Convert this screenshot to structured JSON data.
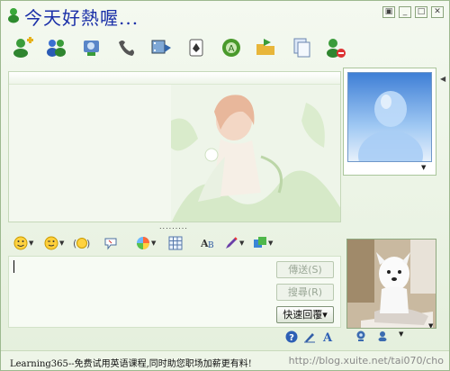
{
  "window": {
    "title": "今天好熱喔...",
    "controls": [
      "▣",
      "_",
      "□",
      "✕"
    ]
  },
  "toolbar": {
    "items": [
      {
        "icon": "invite-contact-icon"
      },
      {
        "icon": "group-chat-icon"
      },
      {
        "icon": "video-call-icon"
      },
      {
        "icon": "phone-call-icon"
      },
      {
        "icon": "media-play-icon"
      },
      {
        "icon": "games-icon"
      },
      {
        "icon": "activities-icon"
      },
      {
        "icon": "send-file-icon"
      },
      {
        "icon": "share-folder-icon"
      },
      {
        "icon": "block-contact-icon"
      }
    ]
  },
  "format_toolbar": {
    "items": [
      {
        "icon": "emoticon-icon"
      },
      {
        "icon": "wink-icon"
      },
      {
        "icon": "voice-clip-icon"
      },
      {
        "icon": "nudge-icon"
      },
      {
        "icon": "background-icon"
      },
      {
        "icon": "grid-icon"
      },
      {
        "icon": "font-icon"
      },
      {
        "icon": "pen-icon"
      },
      {
        "icon": "color-icon"
      }
    ]
  },
  "input": {
    "value": "",
    "send_label": "傳送(S)",
    "search_label": "搜尋(R)",
    "quick_reply_label": "快速回覆▾"
  },
  "input_footer_icons": [
    "help-icon",
    "handwriting-icon",
    "text-icon"
  ],
  "sidebar": {
    "bottom_icons": [
      "webcam-icon",
      "contact-card-icon"
    ]
  },
  "status": {
    "ad_text": "Learning365--免费试用英语课程,同时助您职场加薪更有料!",
    "url": "http://blog.xuite.net/tai070/cho"
  },
  "colors": {
    "title": "#1a2fa8",
    "background": "#eaf3e4",
    "accent_green": "#4a9a2c"
  }
}
